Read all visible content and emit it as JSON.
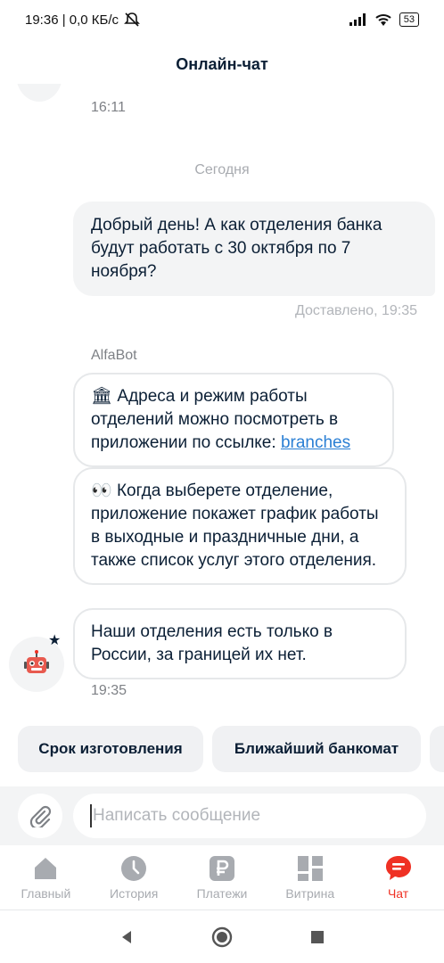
{
  "status_bar": {
    "time_text": "19:36 | 0,0 КБ/с",
    "battery": "53"
  },
  "header": {
    "title": "Онлайн-чат"
  },
  "chat": {
    "prev_time": "16:11",
    "date_separator": "Сегодня",
    "outgoing": {
      "text": "Добрый день! А как отделения банка будут работать с 30 октября по 7 ноября?",
      "status": "Доставлено, 19:35"
    },
    "bot_name": "AlfaBot",
    "incoming": [
      {
        "emoji": "🏛",
        "text": "Адреса и режим работы отделений можно посмотреть в приложении по ссылке: ",
        "link": "branches"
      },
      {
        "emoji": "👀",
        "text": "Когда выберете отделение, приложение покажет график работы в выходные и праздничные дни, а также список услуг этого отделения."
      },
      {
        "text": "Наши отделения есть только в России, за границей их нет."
      }
    ],
    "bot_time": "19:35"
  },
  "quick_replies": [
    "Срок изготовления",
    "Ближайший банкомат"
  ],
  "composer": {
    "placeholder": "Написать сообщение"
  },
  "tabs": [
    {
      "label": "Главный",
      "icon": "home-icon"
    },
    {
      "label": "История",
      "icon": "clock-icon"
    },
    {
      "label": "Платежи",
      "icon": "ruble-icon"
    },
    {
      "label": "Витрина",
      "icon": "showcase-icon"
    },
    {
      "label": "Чат",
      "icon": "chat-icon",
      "active": true
    }
  ],
  "colors": {
    "accent": "#ef3124",
    "link": "#2a7fd4",
    "inactive": "#a8abb0"
  }
}
